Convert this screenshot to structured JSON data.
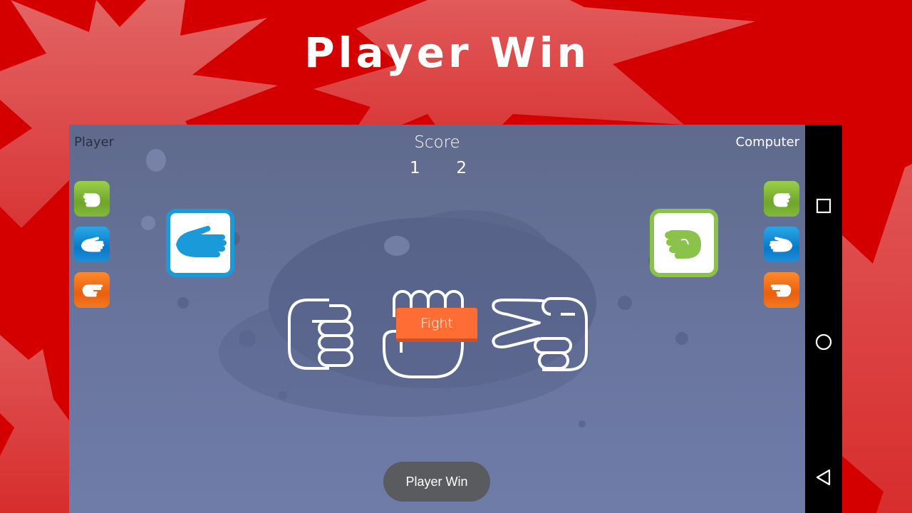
{
  "headline": "Player Win",
  "game": {
    "player_label": "Player",
    "computer_label": "Computer",
    "score": {
      "title": "Score",
      "player": "1",
      "computer": "2"
    },
    "player_choices": [
      {
        "name": "rock",
        "icon": "rock-fist-icon",
        "color": "#7cb342"
      },
      {
        "name": "paper",
        "icon": "paper-hand-icon",
        "color": "#1a8fd8"
      },
      {
        "name": "scissors",
        "icon": "scissors-hand-icon",
        "color": "#f26b1d"
      }
    ],
    "computer_choices": [
      {
        "name": "rock",
        "icon": "rock-fist-icon",
        "color": "#7cb342"
      },
      {
        "name": "paper",
        "icon": "paper-hand-icon",
        "color": "#1a8fd8"
      },
      {
        "name": "scissors",
        "icon": "scissors-hand-icon",
        "color": "#f26b1d"
      }
    ],
    "player_selected": {
      "name": "paper",
      "border_color": "#1a9ad9"
    },
    "computer_selected": {
      "name": "rock",
      "border_color": "#8bc34a"
    },
    "fight_button": "Fight",
    "toast": "Player Win"
  },
  "navbar": {
    "recents": "recents-square-icon",
    "home": "home-circle-icon",
    "back": "back-triangle-icon"
  },
  "colors": {
    "background_red": "#d40000",
    "burst": "#e25656",
    "game_bg": "#66729a",
    "fight": "#ff6d35"
  }
}
